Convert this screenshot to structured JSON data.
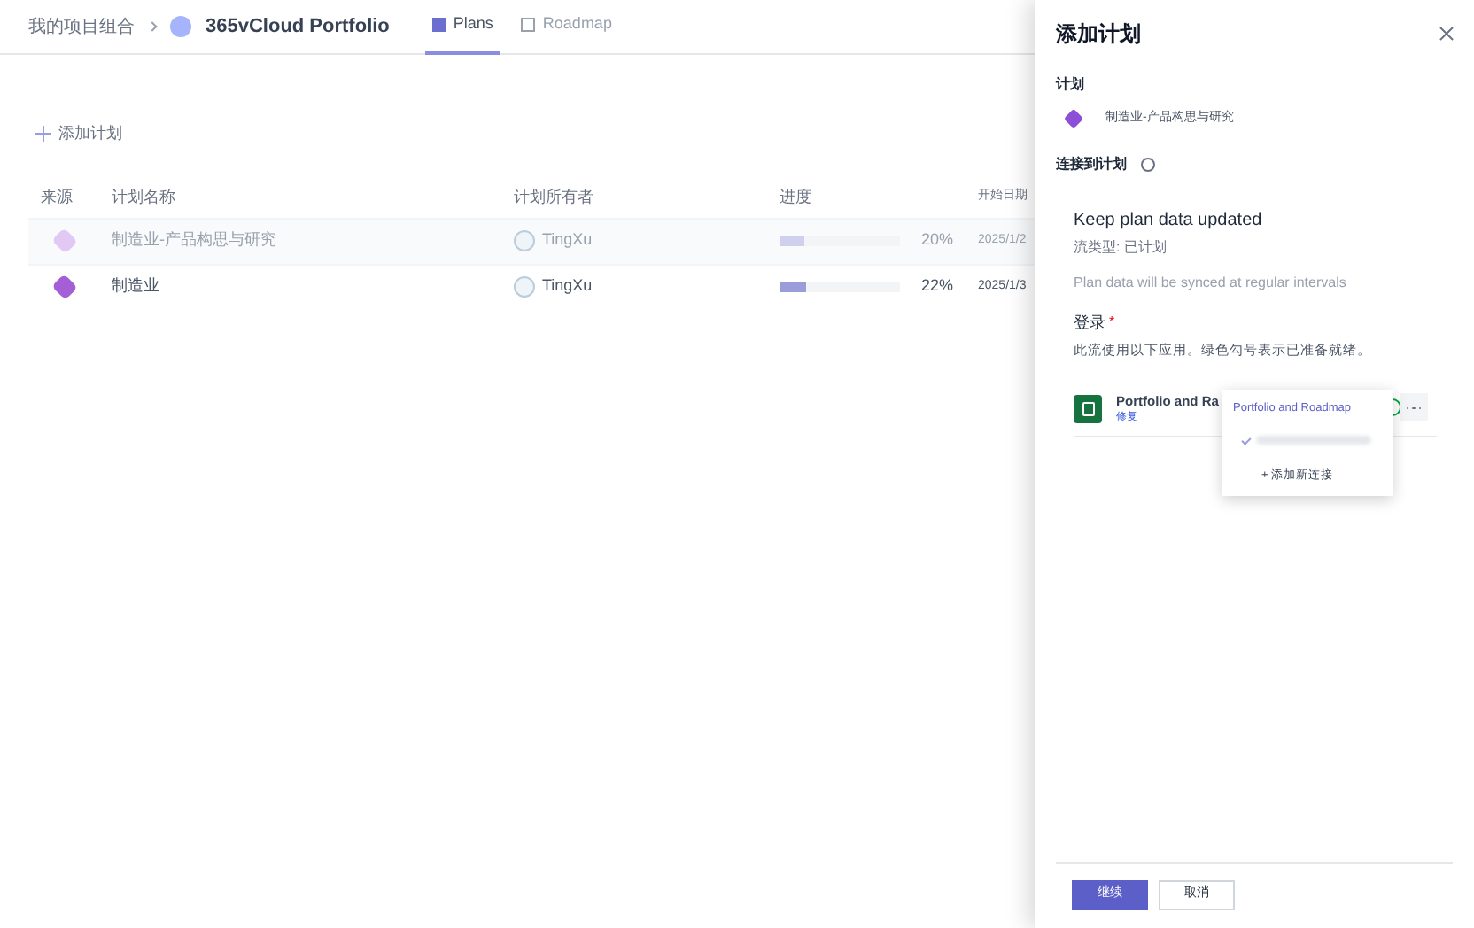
{
  "breadcrumb": {
    "parent": "我的项目组合",
    "current": "365vCloud Portfolio"
  },
  "tabs": [
    {
      "label": "Plans",
      "selected": true
    },
    {
      "label": "Roadmap",
      "selected": false
    }
  ],
  "add_button": "添加计划",
  "table": {
    "columns": [
      "来源",
      "计划名称",
      "计划所有者",
      "进度",
      "开始日期"
    ],
    "rows": [
      {
        "name": "制造业-产品构思与研究",
        "owner": "TingXu",
        "level": 0.2,
        "progress": "20%",
        "start": "2025/1/2",
        "disabled": true
      },
      {
        "name": "制造业",
        "owner": "TingXu",
        "level": 0.22,
        "progress": "22%",
        "start": "2025/1/3",
        "disabled": false
      }
    ]
  },
  "panel": {
    "title": "添加计划",
    "plan_label": "计划",
    "plan_name": "制造业-产品构思与研究",
    "connect_label": "连接到计划",
    "flow_title": "Keep plan data updated",
    "flow_type": "流类型: 已计划",
    "flow_desc": "Plan data will be synced at regular intervals",
    "signin_label": "登录",
    "required_mark": "*",
    "signin_desc": "此流使用以下应用。绿色勾号表示已准备就绪。",
    "app": {
      "name": "Portfolio and Ra",
      "link": "修复"
    },
    "menu": {
      "title": "Portfolio and Roadmap",
      "items": [
        {
          "kind": "account",
          "checked": true
        },
        {
          "kind": "add",
          "label": "+ 添加新连接"
        }
      ]
    },
    "buttons": [
      {
        "label": "继续",
        "primary": true
      },
      {
        "label": "取消",
        "primary": false
      }
    ]
  }
}
